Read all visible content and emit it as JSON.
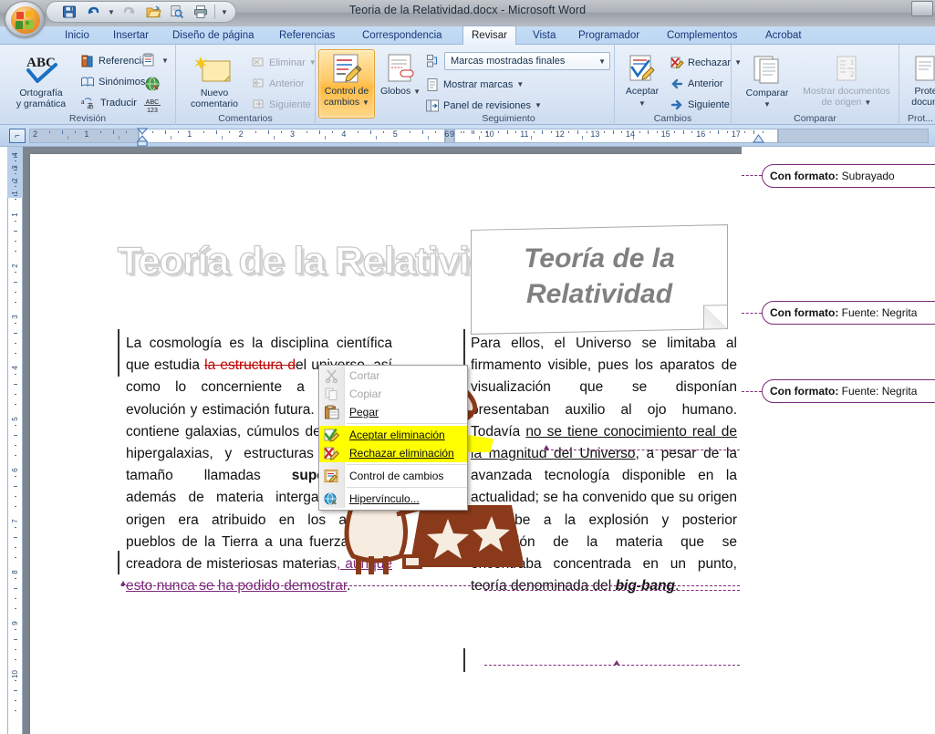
{
  "window": {
    "title": "Teoria de la Relatividad.docx - Microsoft Word"
  },
  "quick_access": {
    "buttons": [
      {
        "name": "save-button",
        "icon": "save-icon",
        "label": "Guardar"
      },
      {
        "name": "undo-button",
        "icon": "undo-icon",
        "label": "Deshacer"
      },
      {
        "name": "undo-dropdown",
        "icon": "chevron-down-icon",
        "label": "Deshacer opciones"
      },
      {
        "name": "redo-button",
        "icon": "redo-icon",
        "label": "Rehacer"
      },
      {
        "name": "open-button",
        "icon": "open-folder-icon",
        "label": "Abrir"
      },
      {
        "name": "print-preview-button",
        "icon": "print-preview-icon",
        "label": "Vista preliminar"
      },
      {
        "name": "print-button",
        "icon": "printer-icon",
        "label": "Imprimir"
      },
      {
        "name": "customize-qat-button",
        "icon": "chevron-down-icon",
        "label": "Personalizar"
      }
    ]
  },
  "tabs": [
    {
      "label": "Inicio",
      "active": false
    },
    {
      "label": "Insertar",
      "active": false
    },
    {
      "label": "Diseño de página",
      "active": false
    },
    {
      "label": "Referencias",
      "active": false
    },
    {
      "label": "Correspondencia",
      "active": false
    },
    {
      "label": "Revisar",
      "active": true
    },
    {
      "label": "Vista",
      "active": false
    },
    {
      "label": "Programador",
      "active": false
    },
    {
      "label": "Complementos",
      "active": false
    },
    {
      "label": "Acrobat",
      "active": false
    }
  ],
  "ribbon": {
    "groups": [
      {
        "name": "revision",
        "label": "Revisión",
        "big_button": "Ortografía\ny gramática",
        "big_button_line1": "Ortografía",
        "big_button_line2": "y gramática",
        "items": [
          {
            "label": "Referencia",
            "icon": "reference-book-icon"
          },
          {
            "label": "Sinónimos",
            "icon": "thesaurus-icon"
          },
          {
            "label": "Traducir",
            "icon": "translate-icon"
          }
        ],
        "right_icons": [
          {
            "name": "translation-screentip-icon"
          },
          {
            "name": "set-language-icon"
          },
          {
            "name": "word-count-icon",
            "caption": "ABC 123"
          }
        ]
      },
      {
        "name": "comentarios",
        "label": "Comentarios",
        "big_button_line1": "Nuevo",
        "big_button_line2": "comentario",
        "items": [
          {
            "label": "Eliminar",
            "icon": "delete-comment-icon",
            "disabled": true,
            "dropdown": true
          },
          {
            "label": "Anterior",
            "icon": "previous-comment-icon",
            "disabled": true
          },
          {
            "label": "Siguiente",
            "icon": "next-comment-icon",
            "disabled": true
          }
        ]
      },
      {
        "name": "seguimiento",
        "label": "Seguimiento",
        "big_button_line1": "Control de",
        "big_button_line2": "cambios",
        "big_button_active": true,
        "globos_line1": "Globos",
        "display_combo": "Marcas mostradas finales",
        "items": [
          {
            "label": "Mostrar marcas",
            "icon": "show-markup-icon",
            "dropdown": true
          },
          {
            "label": "Panel de revisiones",
            "icon": "reviewing-pane-icon",
            "dropdown": true
          }
        ]
      },
      {
        "name": "cambios",
        "label": "Cambios",
        "big_button_line1": "Aceptar",
        "items": [
          {
            "label": "Rechazar",
            "icon": "reject-change-icon",
            "dropdown": true
          },
          {
            "label": "Anterior",
            "icon": "previous-change-icon"
          },
          {
            "label": "Siguiente",
            "icon": "next-change-icon"
          }
        ]
      },
      {
        "name": "comparar",
        "label": "Comparar",
        "big_button_line1": "Comparar",
        "second_line1": "Mostrar documentos",
        "second_line2": "de origen",
        "second_disabled": true
      },
      {
        "name": "proteger",
        "label": "Prot...",
        "big_button_line1": "Prote",
        "big_button_line2": "docum"
      }
    ]
  },
  "ruler": {
    "horizontal_left": [
      "2",
      "1"
    ],
    "horizontal_right": [
      "1",
      "2",
      "3",
      "4",
      "5",
      "6"
    ],
    "horizontal_far": [
      "9",
      "10",
      "11",
      "12",
      "13",
      "14",
      "15",
      "16",
      "17"
    ],
    "vertical_top": [
      "4",
      "3",
      "2",
      "1"
    ],
    "vertical_main": [
      "1",
      "2",
      "3",
      "4",
      "5",
      "6",
      "7",
      "8",
      "9",
      "10"
    ]
  },
  "document": {
    "wordart_title": "Teoría de la Relatividad",
    "textbox_title": "Teoría de la Relatividad",
    "left_column": {
      "run1": "La cosmología es la disciplina científica que estudia ",
      "deleted": "la estructura ",
      "deleted2": "d",
      "run2": "el universo, así como lo concerniente a su origen, evolución y estimación futura. El Universo contiene galaxias, cúmulos de galaxias o hipergalaxias, y estructuras de mayor tamaño llamadas ",
      "bold_word": "supercúmulos",
      "run3": ", además de materia intergaláctica. Su origen era atribuido en los antiguos pueblos de la Tierra a una fuerza divina creadora de misteriosas materias",
      "inserted": ", aunque esto nunca se ha podido demostrar",
      "run4": "."
    },
    "right_column": {
      "run1": "Para ellos, el Universo se limitaba al firmamento visible, pues los aparatos de visualización que se disponían presentaban auxilio al ojo humano. Todavía ",
      "underlined": "no se tiene conocimiento real de la magnitud del Universo",
      "run2": ", a pesar de la avanzada tecnología disponible en la actualidad; se ha convenido que su origen se debe a la explosión y posterior expansión de la materia que se encontraba concentrada en un punto, teoría denominada del ",
      "bold_italic": "big-bang",
      "run3": "."
    },
    "clipart_alt": "telescope-astronomer-clipart"
  },
  "context_menu": {
    "items": [
      {
        "label": "Cortar",
        "icon": "cut-icon",
        "disabled": true,
        "highlighted": false,
        "accel": 3
      },
      {
        "label": "Copiar",
        "icon": "copy-icon",
        "disabled": true,
        "highlighted": false,
        "accel": 0
      },
      {
        "label": "Pegar",
        "icon": "paste-icon",
        "disabled": false,
        "highlighted": false,
        "accel": 0
      },
      {
        "label": "Aceptar eliminación",
        "icon": "accept-change-icon",
        "disabled": false,
        "highlighted": true,
        "accel": 2
      },
      {
        "label": "Rechazar eliminación",
        "icon": "reject-change-icon",
        "disabled": false,
        "highlighted": true,
        "accel": 0
      },
      {
        "label": "Control de cambios",
        "icon": "track-changes-icon",
        "disabled": false,
        "highlighted": false,
        "accel": 13
      },
      {
        "label": "Hipervínculo...",
        "icon": "hyperlink-icon",
        "disabled": false,
        "highlighted": false,
        "accel": 0
      }
    ]
  },
  "format_balloons": [
    {
      "prefix": "Con formato:",
      "value": "Subrayado"
    },
    {
      "prefix": "Con formato:",
      "value": "Fuente: Negrita"
    },
    {
      "prefix": "Con formato:",
      "value": "Fuente: Negrita"
    }
  ],
  "colors": {
    "accent_balloon": "#7b2c7b",
    "deletion": "#c00000",
    "insertion": "#7a2a7a",
    "highlight": "#ffff00",
    "ribbon_active": "#ffb93f"
  }
}
